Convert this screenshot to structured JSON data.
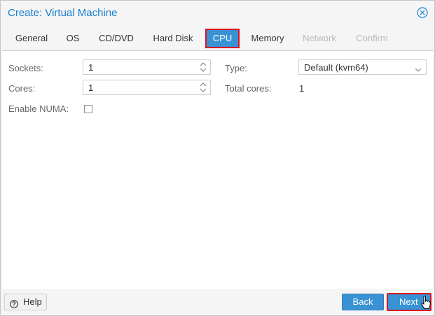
{
  "window": {
    "title": "Create: Virtual Machine"
  },
  "tabs": [
    {
      "label": "General",
      "state": "normal"
    },
    {
      "label": "OS",
      "state": "normal"
    },
    {
      "label": "CD/DVD",
      "state": "normal"
    },
    {
      "label": "Hard Disk",
      "state": "normal"
    },
    {
      "label": "CPU",
      "state": "active"
    },
    {
      "label": "Memory",
      "state": "normal"
    },
    {
      "label": "Network",
      "state": "disabled"
    },
    {
      "label": "Confirm",
      "state": "disabled"
    }
  ],
  "form": {
    "sockets": {
      "label": "Sockets:",
      "value": "1"
    },
    "cores": {
      "label": "Cores:",
      "value": "1"
    },
    "numa": {
      "label": "Enable NUMA:",
      "checked": false
    },
    "type": {
      "label": "Type:",
      "value": "Default (kvm64)"
    },
    "total_cores": {
      "label": "Total cores:",
      "value": "1"
    }
  },
  "footer": {
    "help_label": "Help",
    "back_label": "Back",
    "next_label": "Next"
  },
  "colors": {
    "accent": "#3892d4",
    "title": "#157fcc",
    "highlight": "#e0101f"
  },
  "icons": {
    "close": "close-circle-icon",
    "help": "help-circle-icon",
    "spinner": "up-down-spinner-icon",
    "dropdown": "chevron-down-icon",
    "cursor": "hand-pointer-icon"
  }
}
